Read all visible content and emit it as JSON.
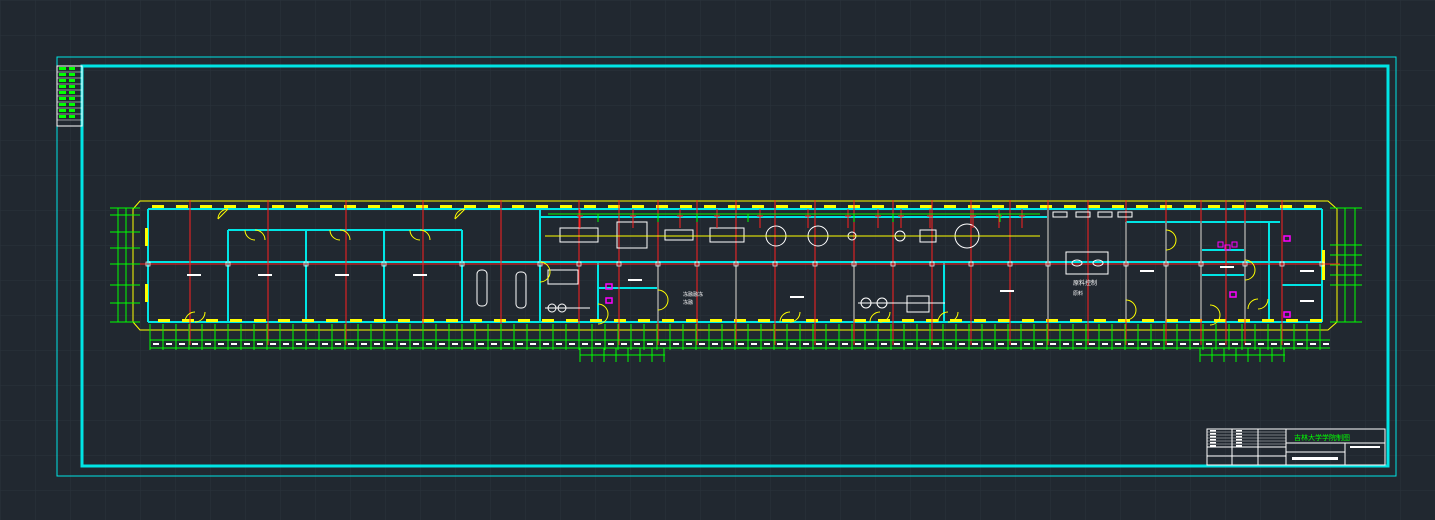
{
  "drawing": {
    "title_block": {
      "school_name": "吉林大学学院制图",
      "room_label_1": "原料控制",
      "room_label_2": "原料",
      "process_label_1": "冻融融冻",
      "process_label_2": "冻融"
    },
    "colors": {
      "background": "#212830",
      "grid": "#2b333c",
      "frame": "#00e5e5",
      "wall": "#00e5e5",
      "axis": "#ff2020",
      "dimension": "#00ff00",
      "outline": "#ffff00",
      "equipment": "#ffffff",
      "accent": "#ff00ff"
    }
  }
}
